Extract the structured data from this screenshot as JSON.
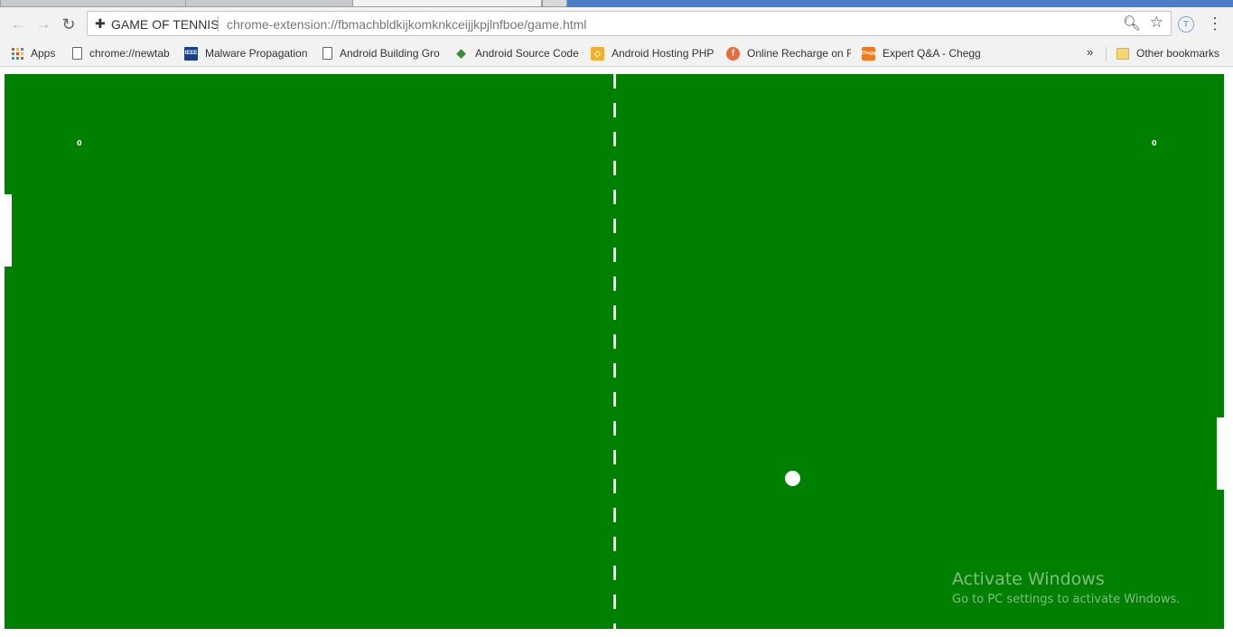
{
  "browser": {
    "site_name": "GAME OF TENNIS",
    "url": "chrome-extension://fbmachbldkijkomknkceijjkpjlnfboe/game.html",
    "ext_badge": "T"
  },
  "bookmarks": [
    {
      "label": "Apps",
      "icon": "apps-grid-icon"
    },
    {
      "label": "chrome://newtab",
      "icon": "page-icon"
    },
    {
      "label": "Malware Propagation",
      "icon": "ieee-icon",
      "badge": "IEEE"
    },
    {
      "label": "Android Building Gro",
      "icon": "page-icon"
    },
    {
      "label": "Android Source Code",
      "icon": "android-icon"
    },
    {
      "label": "Android Hosting PHP",
      "icon": "hosting-icon"
    },
    {
      "label": "Online Recharge on F",
      "icon": "recharge-icon",
      "badge": "f"
    },
    {
      "label": "Expert Q&A - Chegg",
      "icon": "chegg-icon",
      "badge": "Chegg"
    }
  ],
  "other_bookmarks": "Other bookmarks",
  "overflow_glyph": "»",
  "game": {
    "score_left": "0",
    "score_right": "0",
    "court_color": "#008000",
    "line_color": "#ffffff"
  },
  "watermark": {
    "title": "Activate Windows",
    "subtitle": "Go to PC settings to activate Windows."
  }
}
